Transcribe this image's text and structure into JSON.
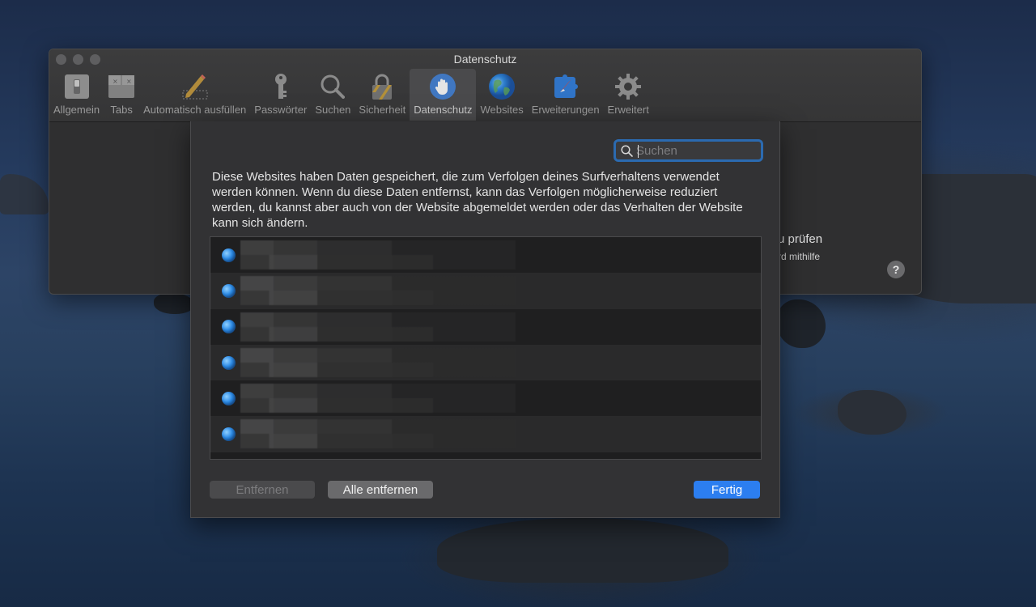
{
  "window": {
    "title": "Datenschutz"
  },
  "toolbar": {
    "items": [
      {
        "label": "Allgemein",
        "icon": "switch-icon"
      },
      {
        "label": "Tabs",
        "icon": "tabs-icon"
      },
      {
        "label": "Automatisch ausfüllen",
        "icon": "pencil-icon"
      },
      {
        "label": "Passwörter",
        "icon": "key-icon"
      },
      {
        "label": "Suchen",
        "icon": "search-icon"
      },
      {
        "label": "Sicherheit",
        "icon": "lock-icon"
      },
      {
        "label": "Datenschutz",
        "icon": "hand-icon",
        "active": true
      },
      {
        "label": "Websites",
        "icon": "globe-icon"
      },
      {
        "label": "Erweiterungen",
        "icon": "puzzle-icon"
      },
      {
        "label": "Erweitert",
        "icon": "gear-icon"
      }
    ]
  },
  "background_panel": {
    "text_a": "u prüfen",
    "text_b": "rd mithilfe",
    "help_label": "?"
  },
  "sheet": {
    "search": {
      "value": "",
      "placeholder": "Suchen"
    },
    "description": "Diese Websites haben Daten gespeichert, die zum Verfolgen deines Surfverhaltens verwendet werden können. Wenn du diese Daten entfernst, kann das Verfolgen möglicherweise reduziert werden, du kannst aber auch von der Website abgemeldet werden oder das Verhalten der Website kann sich ändern.",
    "rows": 6,
    "buttons": {
      "remove": "Entfernen",
      "remove_all": "Alle entfernen",
      "done": "Fertig"
    }
  },
  "colors": {
    "accent": "#2c7ef0",
    "focus_ring": "#2b6ab0"
  }
}
